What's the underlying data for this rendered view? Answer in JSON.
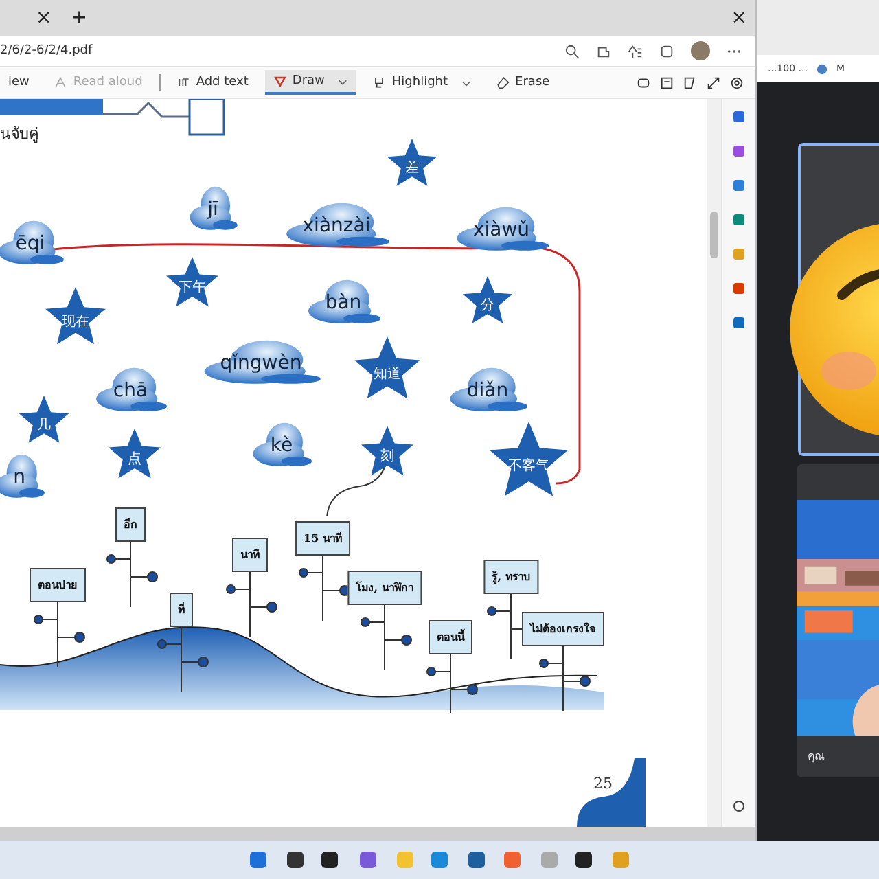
{
  "browser": {
    "tab_close": "×",
    "new_tab": "+",
    "window_close": "×",
    "address": "2/6/2-6/2/4.pdf",
    "toolbar": [
      {
        "label": "iew",
        "kind": "text",
        "selected": false
      },
      {
        "label": "Read aloud",
        "kind": "read",
        "selected": false
      },
      {
        "label": "Add text",
        "kind": "addtext",
        "selected": false
      },
      {
        "label": "Draw",
        "kind": "draw",
        "selected": true
      },
      {
        "label": "Highlight",
        "kind": "highlight",
        "selected": false
      },
      {
        "label": "Erase",
        "kind": "erase",
        "selected": false
      }
    ]
  },
  "worksheet": {
    "heading": "นจับคู่",
    "clouds": [
      {
        "text": "ēqi"
      },
      {
        "text": "jī"
      },
      {
        "text": "xiànzài"
      },
      {
        "text": "xiàwǔ"
      },
      {
        "text": "bàn"
      },
      {
        "text": "qǐngwèn"
      },
      {
        "text": "chā"
      },
      {
        "text": "diǎn"
      },
      {
        "text": "kè"
      },
      {
        "text": "n"
      }
    ],
    "stars": [
      {
        "text": "差"
      },
      {
        "text": "下午"
      },
      {
        "text": "现在"
      },
      {
        "text": "分"
      },
      {
        "text": "知道"
      },
      {
        "text": "几"
      },
      {
        "text": "点"
      },
      {
        "text": "刻"
      },
      {
        "text": "不客气"
      }
    ],
    "signs": [
      {
        "text": "อีก"
      },
      {
        "text": "ตอนบ่าย"
      },
      {
        "text": "ที่"
      },
      {
        "text": "นาที"
      },
      {
        "text": "15 นาที"
      },
      {
        "text": "โมง, นาฬิกา"
      },
      {
        "text": "ตอนนี้"
      },
      {
        "text": "รู้, ทราบ"
      },
      {
        "text": "ไม่ต้องเกรงใจ"
      }
    ],
    "page_number": "25"
  },
  "meeting": {
    "bookmark": "...100 ...",
    "bookmark_2": "M",
    "participant_label": "คุณ"
  }
}
